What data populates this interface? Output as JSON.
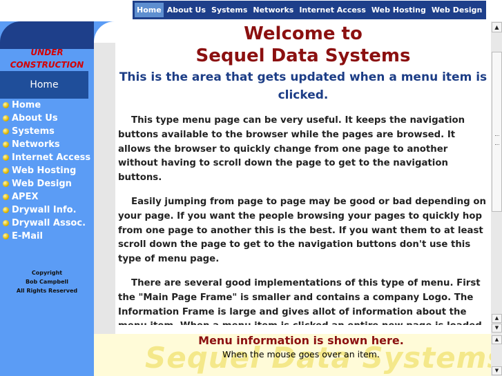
{
  "top_nav": {
    "tabs": [
      {
        "label": "Home",
        "active": true
      },
      {
        "label": "About Us",
        "active": false
      },
      {
        "label": "Systems",
        "active": false
      },
      {
        "label": "Networks",
        "active": false
      },
      {
        "label": "Internet Access",
        "active": false
      },
      {
        "label": "Web Hosting",
        "active": false
      },
      {
        "label": "Web Design",
        "active": false
      }
    ]
  },
  "sidebar": {
    "notice_line1": "UNDER",
    "notice_line2": "CONSTRUCTION",
    "home_label": "Home",
    "items": [
      {
        "label": "Home"
      },
      {
        "label": "About Us"
      },
      {
        "label": "Systems"
      },
      {
        "label": "Networks"
      },
      {
        "label": "Internet Access"
      },
      {
        "label": "Web Hosting"
      },
      {
        "label": "Web Design"
      },
      {
        "label": "APEX"
      },
      {
        "label": "Drywall Info."
      },
      {
        "label": "Drywall Assoc."
      },
      {
        "label": "E-Mail"
      }
    ],
    "copyright_line1": "Copyright",
    "copyright_line2": "Bob Campbell",
    "copyright_line3": "All Rights Reserved"
  },
  "content": {
    "title_line1": "Welcome to",
    "title_line2": "Sequel Data Systems",
    "subtitle": "This is the area that gets updated when a menu item is clicked.",
    "paragraphs": [
      "This type menu page can be very useful. It keeps the navigation buttons available to the browser while the pages are browsed. It allows the browser to quickly change from one page to another without having to scroll down the page to get to the navigation buttons.",
      "Easily jumping from page to page may be good or bad depending on your page. If you want the people browsing your pages to quickly hop from one page to another this is the best. If you want them to at least scroll down the page to get to the navigation buttons don't use this type of menu page.",
      "There are several good implementations of this type of menu. First the \"Main Page Frame\" is smaller and contains a company Logo. The Information Frame is large and gives allot of information about the menu item. When a menu item is clicked an entire new page is loaded over the entire screen."
    ]
  },
  "info_frame": {
    "heading": "Menu information is shown here.",
    "text": "When the mouse goes over an item.",
    "watermark": "Sequel Data Systems"
  },
  "colors": {
    "nav_dark_blue": "#1e3f8a",
    "sidebar_blue": "#5b9cf5",
    "title_red": "#8b1010",
    "subtitle_blue": "#1c3d86",
    "info_bg": "#fffbd8"
  }
}
